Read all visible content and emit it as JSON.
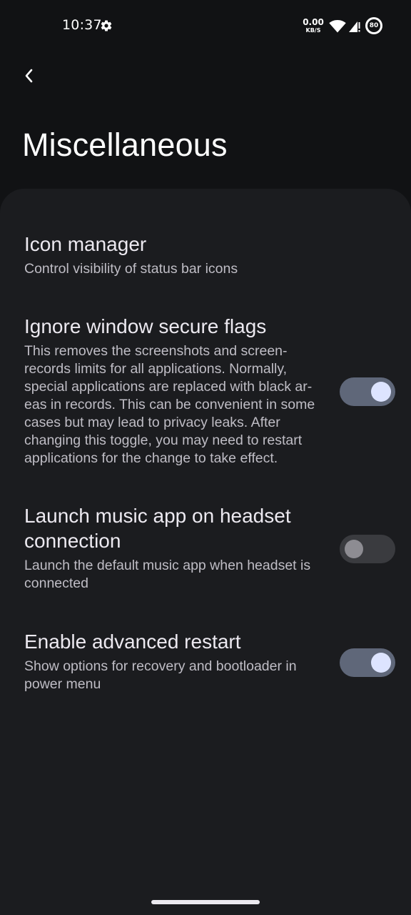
{
  "status_bar": {
    "time": "10:37",
    "net_speed_value": "0.00",
    "net_speed_unit": "KB/S",
    "battery_level": "80",
    "icons": [
      "gear-icon",
      "wifi-icon",
      "cellular-signal-icon",
      "battery-icon"
    ]
  },
  "header": {
    "back_icon": "chevron-left-icon",
    "title": "Miscellaneous"
  },
  "settings": [
    {
      "title": "Icon manager",
      "summary": "Control visibility of status bar icons",
      "has_toggle": false
    },
    {
      "title": "Ignore window secure flags",
      "summary": "This removes the screenshots and screen-records limits for all applications. Normally, special applications are replaced with black ar-eas in records. This can be convenient in some cases but may lead to privacy leaks. After changing this toggle, you may need to restart applications for the change to take effect.",
      "has_toggle": true,
      "toggle_on": true
    },
    {
      "title": "Launch music app on headset connection",
      "summary": "Launch the default music app when headset is connected",
      "has_toggle": true,
      "toggle_on": false
    },
    {
      "title": "Enable advanced restart",
      "summary": "Show options for recovery and bootloader in power menu",
      "has_toggle": true,
      "toggle_on": true
    }
  ],
  "colors": {
    "background": "#111214",
    "card": "#1b1c1f",
    "toggle_on_track": "#5f6779",
    "toggle_on_thumb": "#dde4ff",
    "toggle_off_track": "#3a3b3f",
    "toggle_off_thumb": "#8d8c92"
  }
}
